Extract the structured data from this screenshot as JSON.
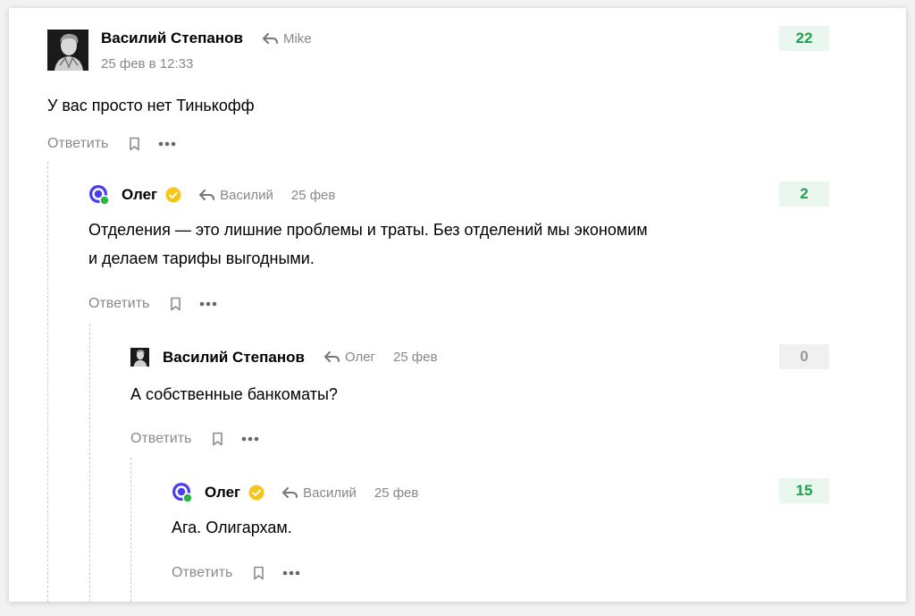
{
  "colors": {
    "accent_positive": "#1fa34a",
    "positive_bg": "#eaf7ee",
    "zero_bg": "#f0f0f0",
    "muted": "#888888",
    "verified": "#f5c518"
  },
  "comments": [
    {
      "author": "Василий Степанов",
      "reply_to": "Mike",
      "date": "25 фев в 12:33",
      "text": "У вас просто нет Тинькофф",
      "reply_label": "Ответить",
      "score": "22",
      "avatar_icon": "portrait-avatar"
    },
    {
      "author": "Олег",
      "verified": true,
      "reply_to": "Василий",
      "date": "25 фев",
      "text_line1": "Отделения — это лишние проблемы и траты. Без отделений мы экономим",
      "text_line2": "и делаем тарифы выгодными.",
      "reply_label": "Ответить",
      "score": "2",
      "avatar_icon": "bank-logo-avatar"
    },
    {
      "author": "Василий Степанов",
      "reply_to": "Олег",
      "date": "25 фев",
      "text": "А собственные банкоматы?",
      "reply_label": "Ответить",
      "score": "0",
      "avatar_icon": "portrait-avatar"
    },
    {
      "author": "Олег",
      "verified": true,
      "reply_to": "Василий",
      "date": "25 фев",
      "text": "Ага. Олигархам.",
      "reply_label": "Ответить",
      "score": "15",
      "avatar_icon": "bank-logo-avatar"
    }
  ]
}
